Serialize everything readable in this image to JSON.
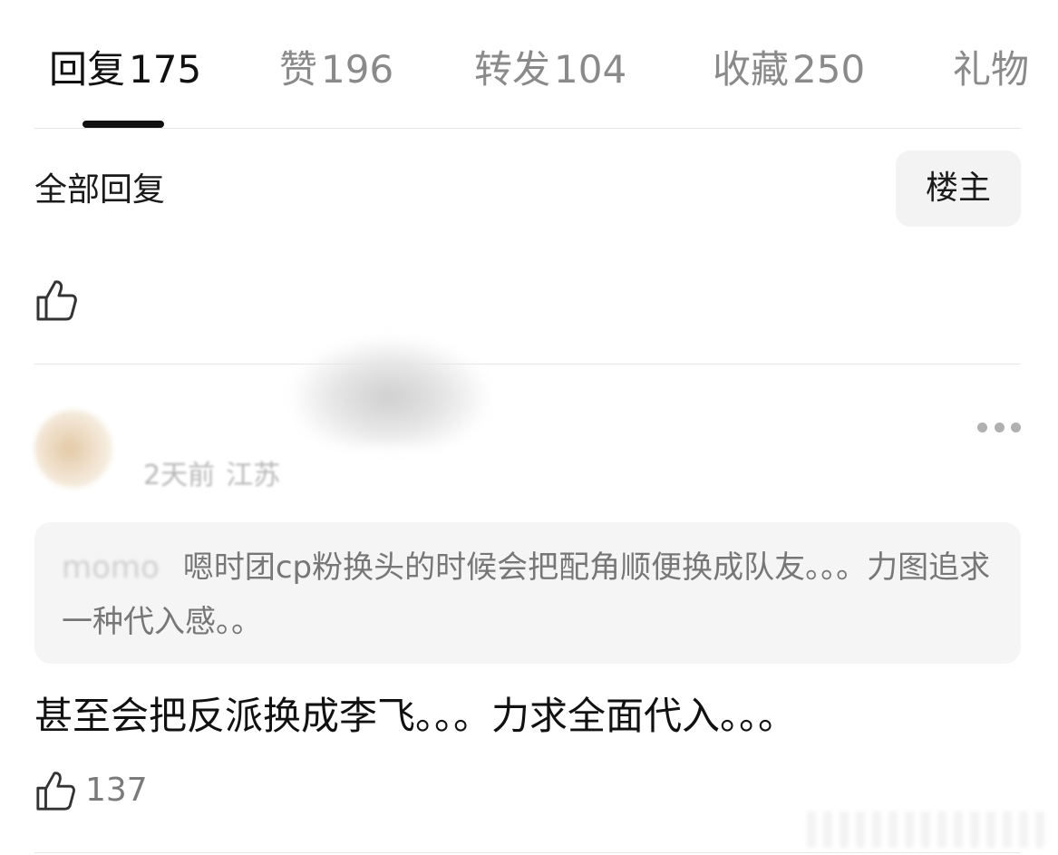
{
  "tabs": [
    {
      "label": "回复",
      "count": "175"
    },
    {
      "label": "赞",
      "count": "196"
    },
    {
      "label": "转发",
      "count": "104"
    },
    {
      "label": "收藏",
      "count": "250"
    },
    {
      "label": "礼物",
      "count": ""
    }
  ],
  "filter": {
    "all_replies_label": "全部回复",
    "owner_button_label": "楼主"
  },
  "comment": {
    "time": "2天前",
    "location": "江苏",
    "quote": {
      "user": "momo",
      "text": "嗯时团cp粉换头的时候会把配角顺便换成队友。。。力图追求一种代入感。。"
    },
    "text": "甚至会把反派换成李飞。。。力求全面代入。。。",
    "like_count": "137"
  },
  "icons": {
    "like": "thumbs-up-icon",
    "more": "more-horizontal-icon"
  },
  "colors": {
    "active_tab": "#111111",
    "inactive_tab": "#8a8a8a",
    "quote_bg": "#f5f5f5",
    "owner_button_bg": "#f3f3f3"
  }
}
